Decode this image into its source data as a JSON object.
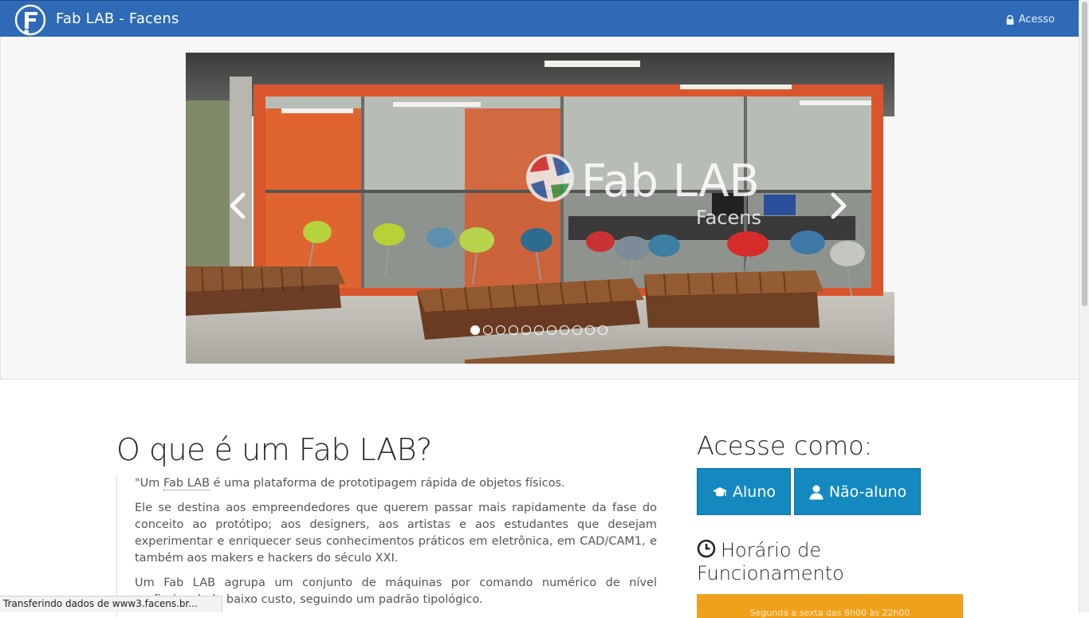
{
  "navbar": {
    "brand": "Fab LAB - Facens",
    "access_label": "Acesso"
  },
  "carousel": {
    "slide_text_main": "Fab LAB",
    "slide_text_sub": "Facens",
    "indicator_count": 11,
    "active_index": 0
  },
  "main": {
    "title": "O que é um Fab LAB?",
    "quote_p1_prefix": "\"Um ",
    "quote_p1_abbr": "Fab LAB",
    "quote_p1_suffix": " é uma plataforma de prototipagem rápida de objetos físicos.",
    "quote_p2": "Ele se destina aos empreendedores que querem passar mais rapidamente da fase do conceito ao protótipo; aos designers, aos artistas e aos estudantes que desejam experimentar e enriquecer seus conhecimentos práticos em eletrônica, em CAD/CAM1, e também aos makers e hackers do século XXI.",
    "quote_p3": "Um Fab LAB agrupa um conjunto de máquinas por comando numérico de nível profissional, de baixo custo, seguindo um padrão tipológico."
  },
  "sidebar": {
    "access_title": "Acesse como:",
    "btn_aluno": "Aluno",
    "btn_naoaluno": "Não-aluno",
    "hours_title": "Horário de Funcionamento",
    "hours_text": "Segunda a sexta das 8h00 às 22h00"
  },
  "status": {
    "text": "Transferindo dados de www3.facens.br..."
  },
  "colors": {
    "navbar": "#2e6ab6",
    "button": "#1389bf",
    "hours_bar": "#f0a11b"
  }
}
